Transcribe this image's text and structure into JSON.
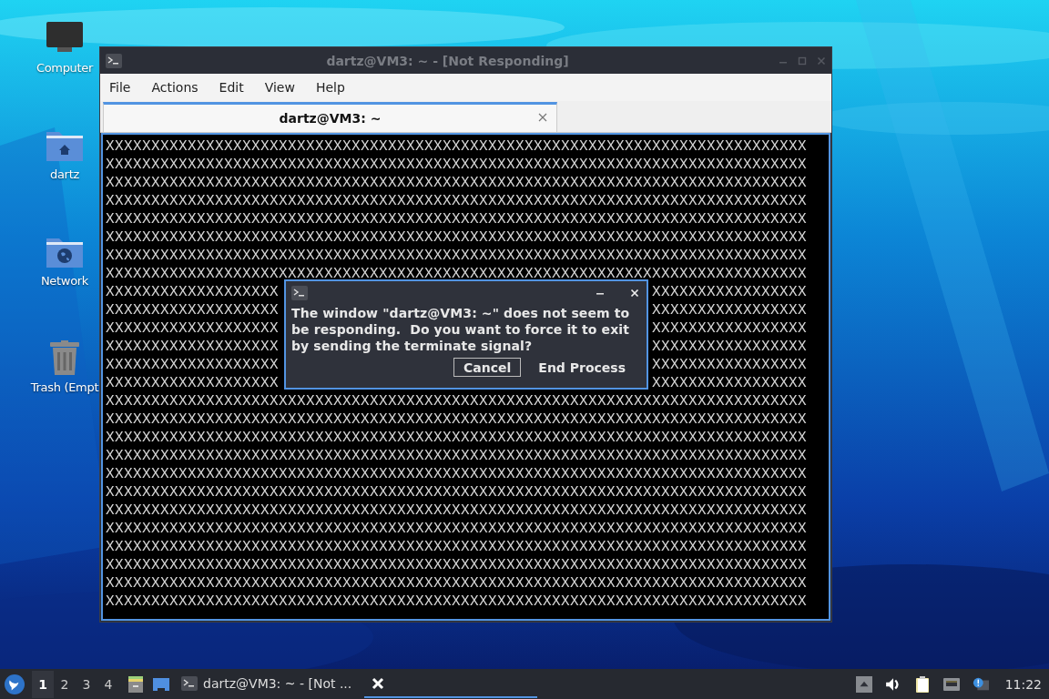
{
  "desktop_icons": [
    {
      "label": "Computer",
      "kind": "computer"
    },
    {
      "label": "dartz",
      "kind": "home"
    },
    {
      "label": "Network",
      "kind": "network"
    },
    {
      "label": "Trash (Empt",
      "kind": "trash"
    }
  ],
  "terminal_window": {
    "title": "dartz@VM3: ~ - [Not Responding]",
    "menu": [
      "File",
      "Actions",
      "Edit",
      "View",
      "Help"
    ],
    "tabs": [
      {
        "label": "dartz@VM3: ~",
        "selected": true
      }
    ],
    "lines": [
      {
        "text": "XXXXXXXXXXXXXXXXXXXXXXXXXXXXXXXXXXXXXXXXXXXXXXXXXXXXXXXXXXXXXXXXXXXXXXXXXXXXX"
      },
      {
        "text": "XXXXXXXXXXXXXXXXXXXXXXXXXXXXXXXXXXXXXXXXXXXXXXXXXXXXXXXXXXXXXXXXXXXXXXXXXXXXX"
      },
      {
        "text": "XXXXXXXXXXXXXXXXXXXXXXXXXXXXXXXXXXXXXXXXXXXXXXXXXXXXXXXXXXXXXXXXXXXXXXXXXXXXX"
      },
      {
        "text": "XXXXXXXXXXXXXXXXXXXXXXXXXXXXXXXXXXXXXXXXXXXXXXXXXXXXXXXXXXXXXXXXXXXXXXXXXXXXX"
      },
      {
        "text": "XXXXXXXXXXXXXXXXXXXXXXXXXXXXXXXXXXXXXXXXXXXXXXXXXXXXXXXXXXXXXXXXXXXXXXXXXXXXX"
      },
      {
        "text": "XXXXXXXXXXXXXXXXXXXXXXXXXXXXXXXXXXXXXXXXXXXXXXXXXXXXXXXXXXXXXXXXXXXXXXXXXXXXX"
      },
      {
        "text": "XXXXXXXXXXXXXXXXXXXXXXXXXXXXXXXXXXXXXXXXXXXXXXXXXXXXXXXXXXXXXXXXXXXXXXXXXXXXX"
      },
      {
        "text": "XXXXXXXXXXXXXXXXXXXXXXXXXXXXXXXXXXXXXXXXXXXXXXXXXXXXXXXXXXXXXXXXXXXXXXXXXXXXX"
      },
      {
        "left": "XXXXXXXXXXXXXXXXXXX",
        "right": "XXXXXXXXXXXXXXXXX"
      },
      {
        "left": "XXXXXXXXXXXXXXXXXXX",
        "right": "XXXXXXXXXXXXXXXXX"
      },
      {
        "left": "XXXXXXXXXXXXXXXXXXX",
        "right": "XXXXXXXXXXXXXXXXX"
      },
      {
        "left": "XXXXXXXXXXXXXXXXXXX",
        "right": "XXXXXXXXXXXXXXXXX"
      },
      {
        "left": "XXXXXXXXXXXXXXXXXXX",
        "right": "XXXXXXXXXXXXXXXXX"
      },
      {
        "left": "XXXXXXXXXXXXXXXXXXX",
        "right": "XXXXXXXXXXXXXXXXX"
      },
      {
        "text": "XXXXXXXXXXXXXXXXXXXXXXXXXXXXXXXXXXXXXXXXXXXXXXXXXXXXXXXXXXXXXXXXXXXXXXXXXXXXX"
      },
      {
        "text": "XXXXXXXXXXXXXXXXXXXXXXXXXXXXXXXXXXXXXXXXXXXXXXXXXXXXXXXXXXXXXXXXXXXXXXXXXXXXX"
      },
      {
        "text": "XXXXXXXXXXXXXXXXXXXXXXXXXXXXXXXXXXXXXXXXXXXXXXXXXXXXXXXXXXXXXXXXXXXXXXXXXXXXX"
      },
      {
        "text": "XXXXXXXXXXXXXXXXXXXXXXXXXXXXXXXXXXXXXXXXXXXXXXXXXXXXXXXXXXXXXXXXXXXXXXXXXXXXX"
      },
      {
        "text": "XXXXXXXXXXXXXXXXXXXXXXXXXXXXXXXXXXXXXXXXXXXXXXXXXXXXXXXXXXXXXXXXXXXXXXXXXXXXX"
      },
      {
        "text": "XXXXXXXXXXXXXXXXXXXXXXXXXXXXXXXXXXXXXXXXXXXXXXXXXXXXXXXXXXXXXXXXXXXXXXXXXXXXX"
      },
      {
        "text": "XXXXXXXXXXXXXXXXXXXXXXXXXXXXXXXXXXXXXXXXXXXXXXXXXXXXXXXXXXXXXXXXXXXXXXXXXXXXX"
      },
      {
        "text": "XXXXXXXXXXXXXXXXXXXXXXXXXXXXXXXXXXXXXXXXXXXXXXXXXXXXXXXXXXXXXXXXXXXXXXXXXXXXX"
      },
      {
        "text": "XXXXXXXXXXXXXXXXXXXXXXXXXXXXXXXXXXXXXXXXXXXXXXXXXXXXXXXXXXXXXXXXXXXXXXXXXXXXX"
      },
      {
        "text": "XXXXXXXXXXXXXXXXXXXXXXXXXXXXXXXXXXXXXXXXXXXXXXXXXXXXXXXXXXXXXXXXXXXXXXXXXXXXX"
      },
      {
        "text": "XXXXXXXXXXXXXXXXXXXXXXXXXXXXXXXXXXXXXXXXXXXXXXXXXXXXXXXXXXXXXXXXXXXXXXXXXXXXX"
      },
      {
        "text": "XXXXXXXXXXXXXXXXXXXXXXXXXXXXXXXXXXXXXXXXXXXXXXXXXXXXXXXXXXXXXXXXXXXXXXXXXXXXX"
      }
    ]
  },
  "dialog": {
    "message": "The window \"dartz@VM3: ~\" does not seem to be responding.  Do you want to force it to exit by sending the terminate signal?",
    "buttons": [
      {
        "label": "Cancel",
        "focused": true
      },
      {
        "label": "End Process",
        "focused": false
      }
    ]
  },
  "taskbar": {
    "workspaces": [
      {
        "label": "1",
        "selected": true
      },
      {
        "label": "2",
        "selected": false
      },
      {
        "label": "3",
        "selected": false
      },
      {
        "label": "4",
        "selected": false
      }
    ],
    "tasks": [
      {
        "kind": "terminal",
        "label": "dartz@VM3: ~ - [Not ...",
        "selected": false
      },
      {
        "kind": "xkill",
        "selected": true
      }
    ],
    "clock": "11:22"
  }
}
